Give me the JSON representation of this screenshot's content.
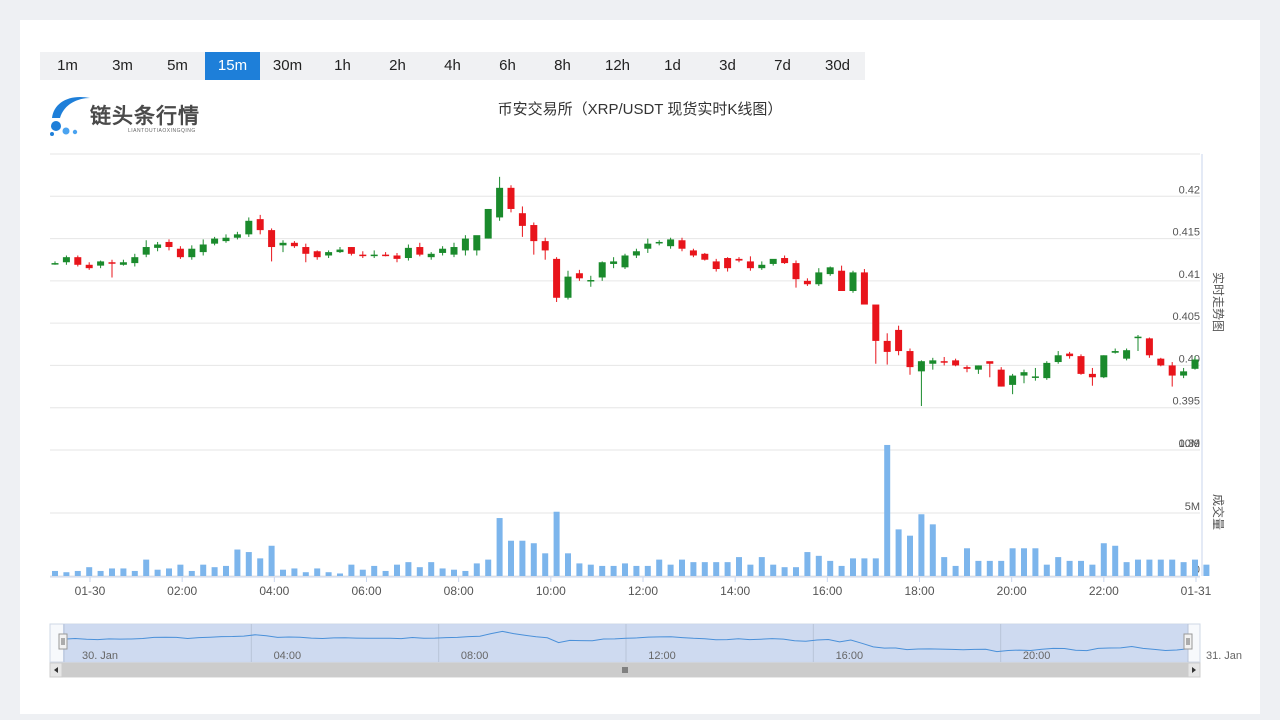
{
  "timeframes": [
    "1m",
    "3m",
    "5m",
    "15m",
    "30m",
    "1h",
    "2h",
    "4h",
    "6h",
    "8h",
    "12h",
    "1d",
    "3d",
    "7d",
    "30d"
  ],
  "active_timeframe": "15m",
  "logo": {
    "name": "链头条行情",
    "sub": "LIANTOUTIAOXINGQING",
    "color": "#1e7fd9"
  },
  "colors": {
    "up": "#1a8a2c",
    "down": "#e8141b",
    "volume": "#7cb5ec",
    "grid": "#e6e6e6",
    "navigator_fill": "#c9d6ee"
  },
  "chart_data": {
    "type": "candlestick",
    "title": "币安交易所（XRP/USDT 现货实时K线图）",
    "price_axis": {
      "label": "实时走势图",
      "min": 0.39,
      "max": 0.425,
      "ticks": [
        0.39,
        0.395,
        0.4,
        0.405,
        0.41,
        0.415,
        0.42
      ],
      "tick_labels": [
        "0.39",
        "0.395",
        "0.40",
        "0.405",
        "0.41",
        "0.415",
        "0.42"
      ]
    },
    "volume_axis": {
      "label": "成交量",
      "min": 0,
      "max": 10000000,
      "ticks": [
        0,
        5000000,
        10000000
      ],
      "tick_labels": [
        "0",
        "5M",
        "10M"
      ]
    },
    "x_axis": {
      "labels": [
        "01-30",
        "02:00",
        "04:00",
        "06:00",
        "08:00",
        "10:00",
        "12:00",
        "14:00",
        "16:00",
        "18:00",
        "20:00",
        "22:00",
        "01-31"
      ],
      "label_hours": [
        0,
        2,
        4,
        6,
        8,
        10,
        12,
        14,
        16,
        18,
        20,
        22,
        24
      ]
    },
    "navigator": {
      "labels": [
        "30. Jan",
        "04:00",
        "08:00",
        "12:00",
        "16:00",
        "20:00",
        "31. Jan"
      ],
      "label_hours": [
        0,
        4,
        8,
        12,
        16,
        20,
        24
      ]
    },
    "candles": [
      [
        0.4121,
        0.4123,
        0.4119,
        0.4121
      ],
      [
        0.4122,
        0.413,
        0.4119,
        0.4128
      ],
      [
        0.4128,
        0.413,
        0.4117,
        0.4119
      ],
      [
        0.4119,
        0.4122,
        0.4113,
        0.4115
      ],
      [
        0.4118,
        0.4124,
        0.4115,
        0.4123
      ],
      [
        0.4122,
        0.4125,
        0.4104,
        0.4121
      ],
      [
        0.4119,
        0.4125,
        0.4118,
        0.4122
      ],
      [
        0.4121,
        0.4132,
        0.4117,
        0.4128
      ],
      [
        0.4131,
        0.4148,
        0.4128,
        0.414
      ],
      [
        0.4139,
        0.4146,
        0.4135,
        0.4143
      ],
      [
        0.4146,
        0.4149,
        0.4136,
        0.414
      ],
      [
        0.4138,
        0.4141,
        0.4126,
        0.4128
      ],
      [
        0.4128,
        0.4142,
        0.4125,
        0.4138
      ],
      [
        0.4134,
        0.4149,
        0.413,
        0.4143
      ],
      [
        0.4144,
        0.4152,
        0.4142,
        0.415
      ],
      [
        0.4147,
        0.4155,
        0.4145,
        0.4151
      ],
      [
        0.4151,
        0.4158,
        0.4149,
        0.4155
      ],
      [
        0.4155,
        0.4175,
        0.4152,
        0.4171
      ],
      [
        0.4173,
        0.4178,
        0.4155,
        0.416
      ],
      [
        0.416,
        0.4162,
        0.4123,
        0.414
      ],
      [
        0.4142,
        0.4148,
        0.4134,
        0.4145
      ],
      [
        0.4145,
        0.4147,
        0.4139,
        0.4141
      ],
      [
        0.414,
        0.4144,
        0.4122,
        0.4132
      ],
      [
        0.4135,
        0.4136,
        0.4125,
        0.4128
      ],
      [
        0.413,
        0.4136,
        0.4127,
        0.4134
      ],
      [
        0.4134,
        0.414,
        0.4133,
        0.4137
      ],
      [
        0.414,
        0.414,
        0.413,
        0.4132
      ],
      [
        0.4131,
        0.4135,
        0.4127,
        0.413
      ],
      [
        0.413,
        0.4136,
        0.4127,
        0.4131
      ],
      [
        0.4131,
        0.4134,
        0.4129,
        0.413
      ],
      [
        0.413,
        0.4133,
        0.4122,
        0.4126
      ],
      [
        0.4127,
        0.4143,
        0.4124,
        0.4139
      ],
      [
        0.414,
        0.4145,
        0.4129,
        0.4131
      ],
      [
        0.4128,
        0.4134,
        0.4125,
        0.4132
      ],
      [
        0.4133,
        0.4141,
        0.413,
        0.4138
      ],
      [
        0.4131,
        0.4145,
        0.4128,
        0.414
      ],
      [
        0.4136,
        0.4154,
        0.413,
        0.415
      ],
      [
        0.4136,
        0.4144,
        0.413,
        0.4154
      ],
      [
        0.415,
        0.4185,
        0.415,
        0.4185
      ],
      [
        0.4175,
        0.4223,
        0.4171,
        0.421
      ],
      [
        0.421,
        0.4213,
        0.4181,
        0.4185
      ],
      [
        0.418,
        0.4188,
        0.4152,
        0.4165
      ],
      [
        0.4166,
        0.4169,
        0.4131,
        0.4147
      ],
      [
        0.4147,
        0.4151,
        0.4125,
        0.4136
      ],
      [
        0.4126,
        0.4128,
        0.4075,
        0.408
      ],
      [
        0.408,
        0.4112,
        0.4078,
        0.4105
      ],
      [
        0.4109,
        0.4113,
        0.41,
        0.4103
      ],
      [
        0.41,
        0.4106,
        0.4093,
        0.4101
      ],
      [
        0.4104,
        0.4123,
        0.41,
        0.4122
      ],
      [
        0.412,
        0.4128,
        0.4115,
        0.4123
      ],
      [
        0.4116,
        0.4132,
        0.4114,
        0.413
      ],
      [
        0.413,
        0.4138,
        0.4127,
        0.4135
      ],
      [
        0.4138,
        0.415,
        0.4133,
        0.4144
      ],
      [
        0.4146,
        0.4148,
        0.4142,
        0.4146
      ],
      [
        0.4141,
        0.4151,
        0.4138,
        0.4149
      ],
      [
        0.4148,
        0.4151,
        0.4135,
        0.4138
      ],
      [
        0.4136,
        0.4138,
        0.4128,
        0.413
      ],
      [
        0.4132,
        0.4133,
        0.4124,
        0.4125
      ],
      [
        0.4123,
        0.4126,
        0.4111,
        0.4114
      ],
      [
        0.4127,
        0.4128,
        0.4111,
        0.4115
      ],
      [
        0.4126,
        0.4128,
        0.4122,
        0.4124
      ],
      [
        0.4123,
        0.4129,
        0.4112,
        0.4115
      ],
      [
        0.4115,
        0.4123,
        0.4113,
        0.4119
      ],
      [
        0.412,
        0.4125,
        0.4118,
        0.4126
      ],
      [
        0.4127,
        0.413,
        0.412,
        0.4121
      ],
      [
        0.4121,
        0.4124,
        0.4092,
        0.4102
      ],
      [
        0.41,
        0.4103,
        0.4094,
        0.4096
      ],
      [
        0.4096,
        0.4115,
        0.4094,
        0.411
      ],
      [
        0.4108,
        0.4117,
        0.4106,
        0.4116
      ],
      [
        0.4112,
        0.4118,
        0.41,
        0.4088
      ],
      [
        0.4088,
        0.4112,
        0.4086,
        0.411
      ],
      [
        0.411,
        0.4114,
        0.4102,
        0.4072
      ],
      [
        0.4072,
        0.4046,
        0.4002,
        0.4029
      ],
      [
        0.4029,
        0.4038,
        0.4001,
        0.4016
      ],
      [
        0.4042,
        0.4047,
        0.4012,
        0.4017
      ],
      [
        0.4017,
        0.402,
        0.3989,
        0.3998
      ],
      [
        0.3993,
        0.4006,
        0.3952,
        0.4005
      ],
      [
        0.4002,
        0.4009,
        0.3995,
        0.4006
      ],
      [
        0.4005,
        0.401,
        0.4,
        0.4004
      ],
      [
        0.4006,
        0.4008,
        0.3999,
        0.4
      ],
      [
        0.3998,
        0.4,
        0.3992,
        0.3996
      ],
      [
        0.3995,
        0.4,
        0.399,
        0.4
      ],
      [
        0.4005,
        0.4004,
        0.3986,
        0.4002
      ],
      [
        0.3995,
        0.3998,
        0.3975,
        0.3975
      ],
      [
        0.3977,
        0.399,
        0.3966,
        0.3988
      ],
      [
        0.3988,
        0.3995,
        0.3979,
        0.3992
      ],
      [
        0.3986,
        0.3997,
        0.3982,
        0.3987
      ],
      [
        0.3985,
        0.4005,
        0.3983,
        0.4003
      ],
      [
        0.4004,
        0.4017,
        0.4002,
        0.4012
      ],
      [
        0.4014,
        0.4016,
        0.4008,
        0.4011
      ],
      [
        0.4011,
        0.4013,
        0.3989,
        0.399
      ],
      [
        0.399,
        0.3997,
        0.3976,
        0.3986
      ],
      [
        0.3986,
        0.4012,
        0.3985,
        0.4012
      ],
      [
        0.4015,
        0.402,
        0.4014,
        0.4017
      ],
      [
        0.4008,
        0.402,
        0.4006,
        0.4018
      ],
      [
        0.4034,
        0.4036,
        0.4017,
        0.4034
      ],
      [
        0.4032,
        0.4033,
        0.4009,
        0.4012
      ],
      [
        0.4008,
        0.4009,
        0.3999,
        0.4
      ],
      [
        0.4,
        0.4004,
        0.3975,
        0.3988
      ],
      [
        0.3988,
        0.3997,
        0.3985,
        0.3993
      ],
      [
        0.3996,
        0.4011,
        0.3995,
        0.4007
      ]
    ],
    "volumes": [
      0.4,
      0.3,
      0.4,
      0.7,
      0.4,
      0.6,
      0.6,
      0.4,
      1.3,
      0.5,
      0.6,
      0.9,
      0.4,
      0.9,
      0.7,
      0.8,
      2.1,
      1.9,
      1.4,
      2.4,
      0.5,
      0.6,
      0.3,
      0.6,
      0.3,
      0.2,
      0.9,
      0.5,
      0.8,
      0.4,
      0.9,
      1.1,
      0.7,
      1.1,
      0.6,
      0.5,
      0.4,
      1.0,
      1.3,
      4.6,
      2.8,
      2.8,
      2.6,
      1.8,
      5.1,
      1.8,
      1.0,
      0.9,
      0.8,
      0.8,
      1.0,
      0.8,
      0.8,
      1.3,
      0.9,
      1.3,
      1.1,
      1.1,
      1.1,
      1.1,
      1.5,
      0.9,
      1.5,
      0.9,
      0.7,
      0.7,
      1.9,
      1.6,
      1.2,
      0.8,
      1.4,
      1.4,
      1.4,
      10.4,
      3.7,
      3.2,
      4.9,
      4.1,
      1.5,
      0.8,
      2.2,
      1.2,
      1.2,
      1.2,
      2.2,
      2.2,
      2.2,
      0.9,
      1.5,
      1.2,
      1.2,
      0.9,
      2.6,
      2.4,
      1.1,
      1.3,
      1.3,
      1.3,
      1.3,
      1.1,
      1.3,
      0.9
    ]
  }
}
